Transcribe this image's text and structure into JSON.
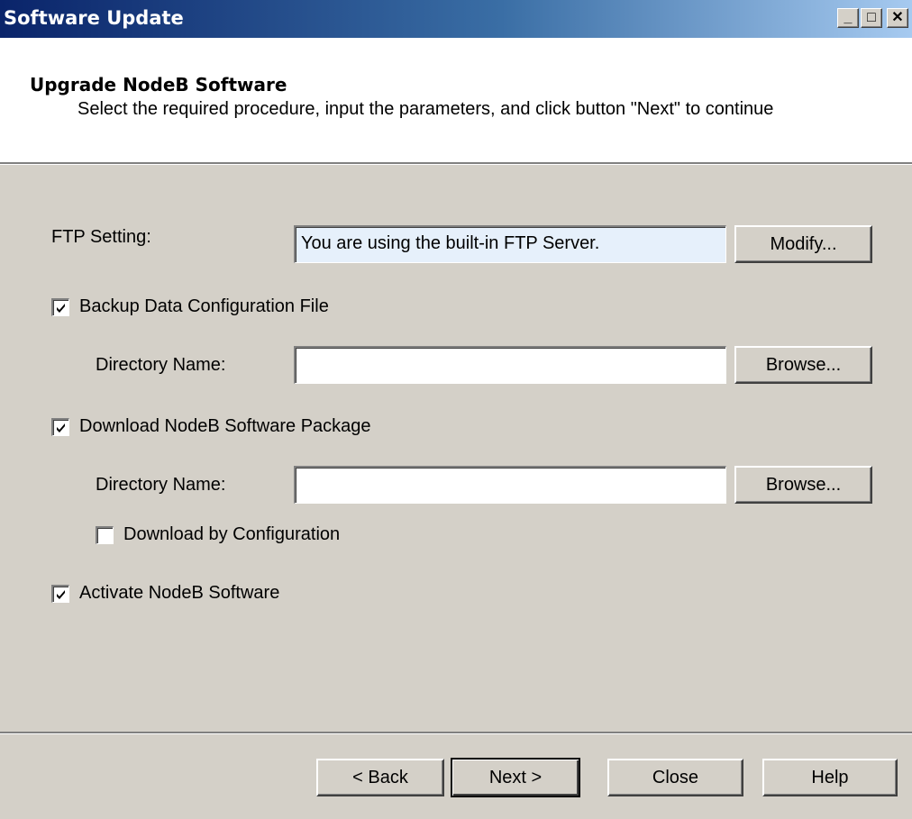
{
  "window": {
    "title": "Software Update",
    "controls": {
      "minimize": "_",
      "maximize": "□",
      "close": "✕"
    }
  },
  "header": {
    "title": "Upgrade NodeB Software",
    "subtitle": "Select the required procedure, input the parameters, and click button \"Next\" to continue"
  },
  "ftp": {
    "label": "FTP Setting:",
    "value": "You are using the built-in FTP Server.",
    "modify_label": "Modify..."
  },
  "backup": {
    "checkbox_label": "Backup Data Configuration File",
    "checked": true,
    "dir_label": "Directory Name:",
    "dir_value": "",
    "browse_label": "Browse..."
  },
  "download": {
    "checkbox_label": "Download NodeB Software Package",
    "checked": true,
    "dir_label": "Directory Name:",
    "dir_value": "",
    "browse_label": "Browse...",
    "by_config_label": "Download by Configuration",
    "by_config_checked": false
  },
  "activate": {
    "checkbox_label": "Activate NodeB Software",
    "checked": true
  },
  "footer": {
    "back_label": "< Back",
    "next_label": "Next >",
    "close_label": "Close",
    "help_label": "Help"
  }
}
